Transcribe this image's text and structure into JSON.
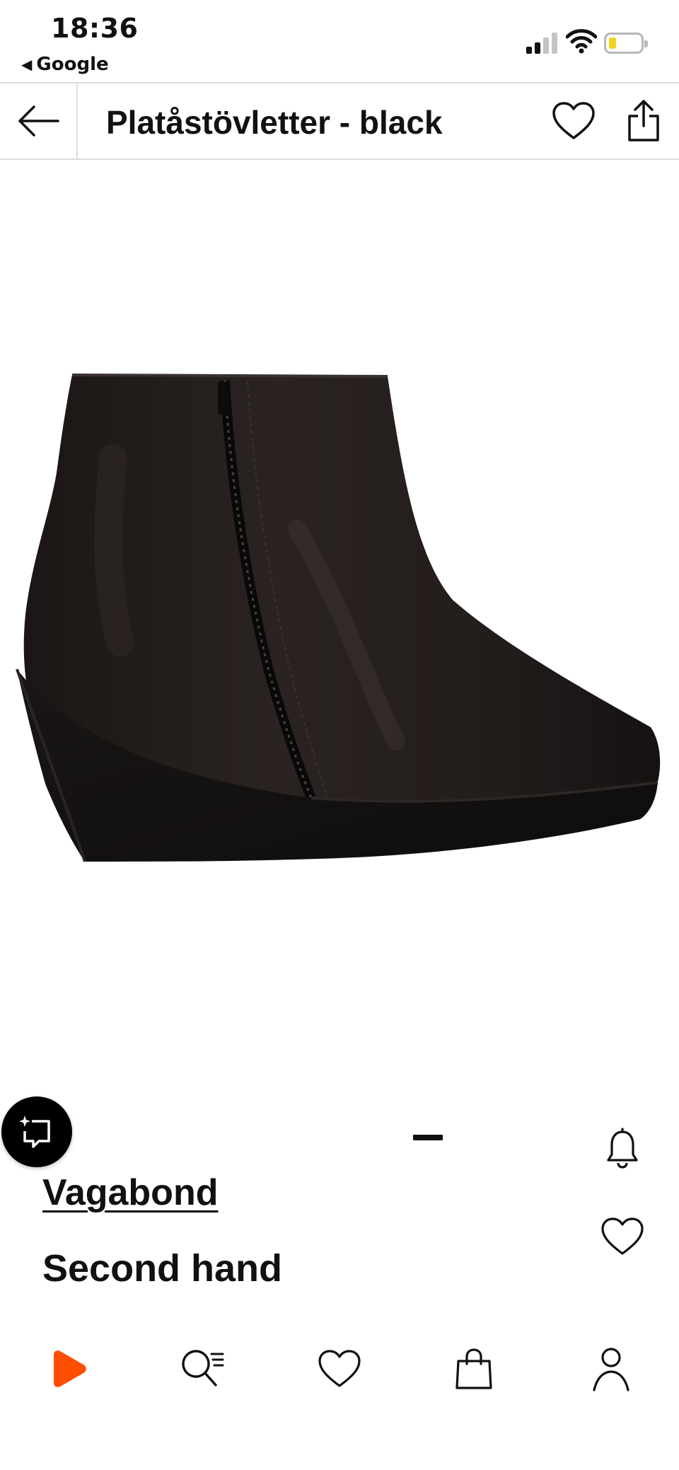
{
  "status_bar": {
    "time": "18:36",
    "back_app": "Google",
    "back_arrow_icon": "triangle-left-icon",
    "signal_icon": "cellular-signal-icon",
    "wifi_icon": "wifi-icon",
    "battery_icon": "battery-low-icon",
    "battery_level": 0.15,
    "battery_color": "#f3d41a"
  },
  "header": {
    "back_icon": "arrow-left-icon",
    "title": "Platåstövletter - black",
    "wishlist_icon": "heart-outline-icon",
    "share_icon": "share-icon"
  },
  "product": {
    "image_icon": "ankle-boot-image",
    "similar_icon": "find-similar-icon",
    "notify_icon": "bell-icon",
    "wishlist_icon": "heart-outline-icon",
    "image_count_indicator": 1,
    "brand": "Vagabond",
    "condition": "Second hand"
  },
  "bottom_nav": {
    "items": [
      {
        "icon": "zalando-logo-icon",
        "color": "#ff4e00"
      },
      {
        "icon": "search-icon"
      },
      {
        "icon": "heart-outline-icon"
      },
      {
        "icon": "shopping-bag-icon"
      },
      {
        "icon": "user-icon"
      }
    ]
  },
  "colors": {
    "accent": "#ff4e00",
    "text": "#111111",
    "divider": "#dcdcdc"
  }
}
